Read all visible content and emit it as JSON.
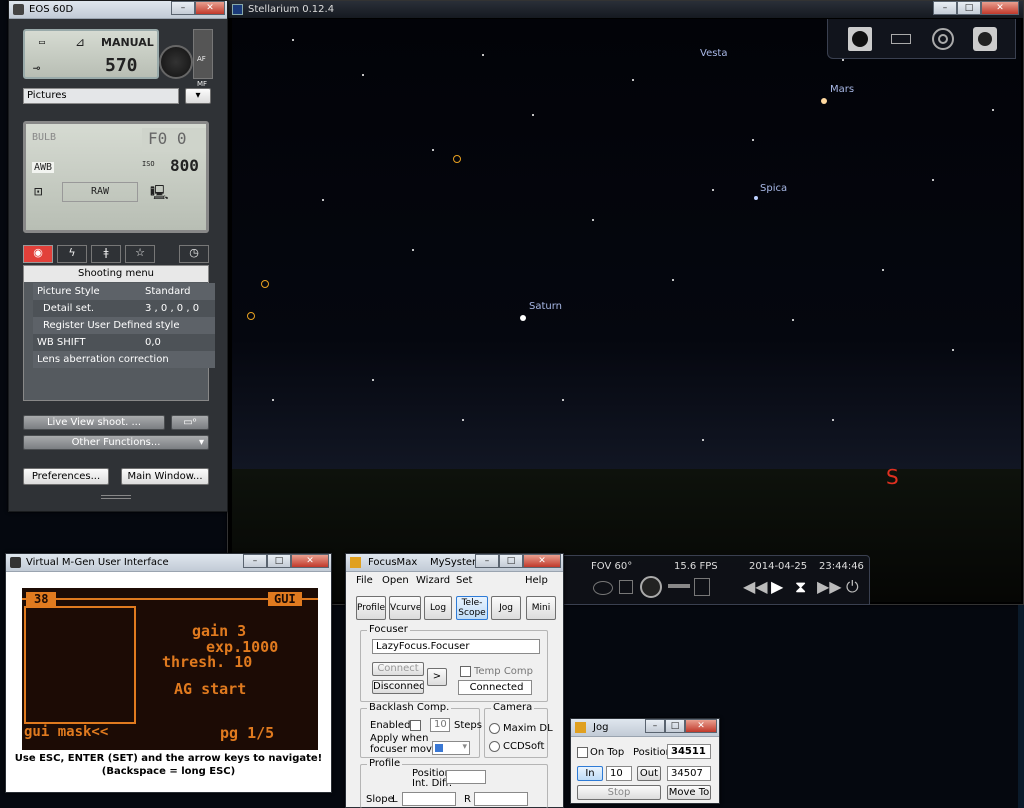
{
  "eos": {
    "title": "EOS 60D",
    "mode": "MANUAL",
    "shots": "570",
    "af_label": "AF",
    "mf_label": "MF",
    "folder": "Pictures",
    "bulb": "BULB",
    "fnum": "F0 0",
    "awb": "AWB",
    "iso_label": "ISO",
    "iso": "800",
    "raw": "RAW",
    "menu_title": "Shooting menu",
    "menu_rows": [
      {
        "label": "Picture Style",
        "value": "Standard"
      },
      {
        "label": "Detail set.",
        "value": "3 , 0 , 0 , 0"
      },
      {
        "label": "Register User Defined style",
        "value": ""
      },
      {
        "label": "WB SHIFT",
        "value": "0,0"
      },
      {
        "label": "Lens aberration correction",
        "value": ""
      }
    ],
    "live_view": "Live View shoot. ...",
    "other_functions": "Other Functions...",
    "preferences": "Preferences...",
    "main_window": "Main Window..."
  },
  "stellarium": {
    "title": "Stellarium 0.12.4",
    "labels": {
      "vesta": "Vesta",
      "mars": "Mars",
      "spica": "Spica",
      "saturn": "Saturn"
    },
    "compass": "S",
    "fov": "FOV 60°",
    "fps": "15.6 FPS",
    "date": "2014-04-25",
    "time": "23:44:46"
  },
  "mgen": {
    "title": "Virtual M-Gen User Interface",
    "screen": {
      "top_left": "38",
      "top_right": "GUI",
      "line1": "gain  3",
      "line2": "exp.1000",
      "line3": "thresh.  10",
      "line4": "AG start",
      "bottom_left": "gui mask<<",
      "bottom_right": "pg 1/5"
    },
    "help1": "Use ESC, ENTER (SET) and the arrow keys to navigate!",
    "help2": "(Backspace = long ESC)"
  },
  "focusmax": {
    "title": "FocusMax    MySystem",
    "menu": [
      "File",
      "Open",
      "Wizard",
      "Set",
      "Help"
    ],
    "tabs": [
      "Profile",
      "Vcurve",
      "Log",
      "Tele-\nScope",
      "Jog",
      "Mini"
    ],
    "focuser_group": "Focuser",
    "focuser_name": "LazyFocus.Focuser",
    "connect": "Connect",
    "disconnect": "Disconnect",
    "arrow": ">",
    "temp_comp": "Temp Comp",
    "status": "Connected",
    "backlash_group": "Backlash Comp.",
    "enabled": "Enabled",
    "steps_value": "10",
    "steps": "Steps",
    "apply_when": "Apply when",
    "focuser_moves": "focuser moves:",
    "camera_group": "Camera",
    "maxim": "Maxim DL",
    "ccdsoft": "CCDSoft",
    "profile_group": "Profile",
    "position": "Position",
    "int_diff": "Int. Diff.",
    "slope": "Slope",
    "l": "L",
    "r": "R"
  },
  "jog": {
    "title": "Jog",
    "on_top": "On Top",
    "position_label": "Position",
    "position": "34511",
    "in": "In",
    "step": "10",
    "out": "Out",
    "target": "34507",
    "stop": "Stop",
    "move_to": "Move To"
  },
  "colors": {
    "sky_top": "#020308",
    "sky_horizon": "#1b2030",
    "planet_marker": "#e8a020",
    "cardinal": "#e03020",
    "lcd_orange": "#e07a1f"
  }
}
